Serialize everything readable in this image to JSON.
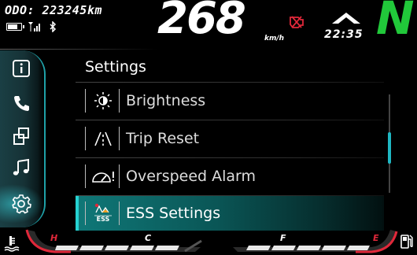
{
  "status": {
    "odometer": "ODO: 223245km",
    "speed": "268",
    "speed_unit": "km/h",
    "time": "22:35",
    "gear": "N",
    "icons": [
      "battery-icon",
      "signal-icon",
      "bluetooth-icon",
      "engine-warning-icon",
      "navigation-arrow-icon"
    ]
  },
  "sidebar": {
    "items": [
      {
        "name": "info",
        "icon": "info-icon"
      },
      {
        "name": "phone",
        "icon": "phone-icon"
      },
      {
        "name": "apps",
        "icon": "apps-icon"
      },
      {
        "name": "music",
        "icon": "music-icon"
      },
      {
        "name": "settings",
        "icon": "settings-gear-icon",
        "active": true
      }
    ]
  },
  "settings": {
    "title": "Settings",
    "items": [
      {
        "label": "Brightness",
        "icon": "brightness-icon"
      },
      {
        "label": "Trip Reset",
        "icon": "trip-reset-icon"
      },
      {
        "label": "Overspeed Alarm",
        "icon": "overspeed-alarm-icon"
      },
      {
        "label": "ESS Settings",
        "icon": "ess-icon",
        "selected": true
      }
    ],
    "ess_icon_text": "ESS"
  },
  "gauges": {
    "temp_hot": "H",
    "temp_cold": "C",
    "fuel_full": "F",
    "fuel_empty": "E"
  },
  "colors": {
    "accent": "#25d2d2",
    "gear": "#21c83a",
    "warning": "#e0283a",
    "highlight": "#0f7777"
  }
}
